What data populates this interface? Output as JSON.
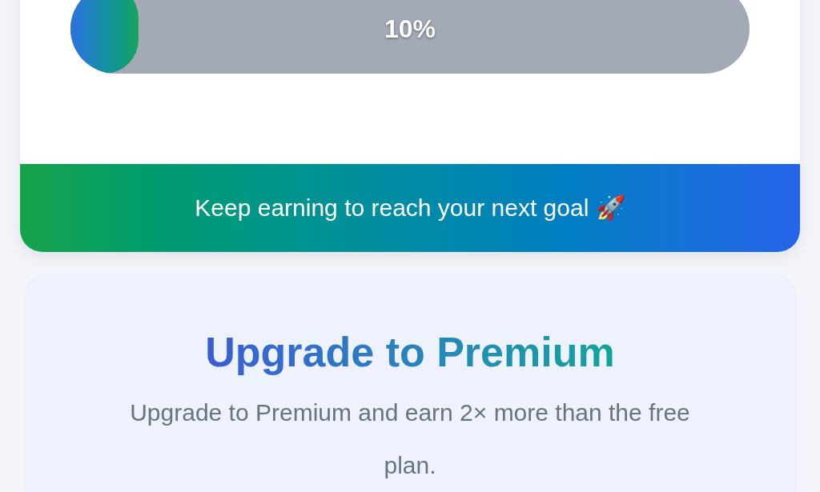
{
  "progress": {
    "level": 0.1,
    "reading": "10%"
  },
  "goal_banner": {
    "text": "Keep earning to reach your next goal 🚀"
  },
  "premium_card": {
    "title": "Upgrade to Premium",
    "description": "Upgrade to Premium and earn 2× more than the free plan."
  }
}
